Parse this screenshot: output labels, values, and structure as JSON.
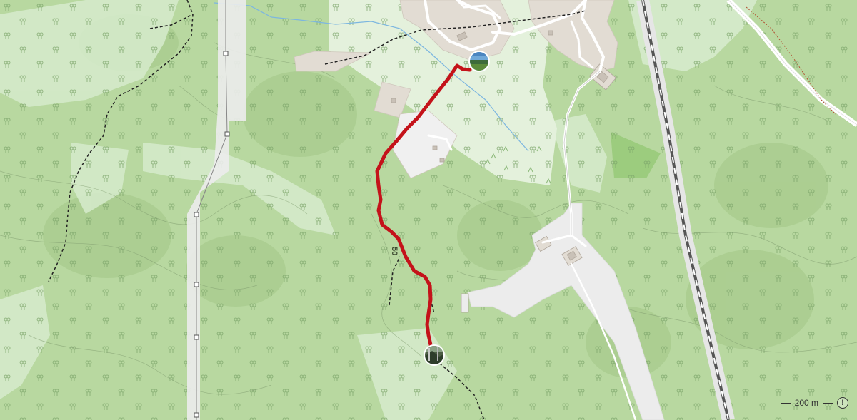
{
  "map": {
    "contour_label": "50",
    "colors": {
      "forest": "#b8d8a0",
      "forest_dark": "#a9cd8e",
      "meadow": "#d6ebcc",
      "clearing": "#e7f2df",
      "urban": "#e2dcd3",
      "building": "#c9c1b7",
      "route": "#c4121a",
      "footpath": "#222222",
      "road": "#ffffff",
      "railway": "#555555",
      "stream": "#7cb6e0",
      "tree_symbol": "#7ca56a"
    },
    "route": {
      "start_marker_icon": "landscape-photo-icon",
      "end_marker_icon": "forest-photo-icon"
    }
  },
  "controls": {
    "scale_label": "200 m",
    "info_icon": "info-icon",
    "info_glyph": "!"
  }
}
